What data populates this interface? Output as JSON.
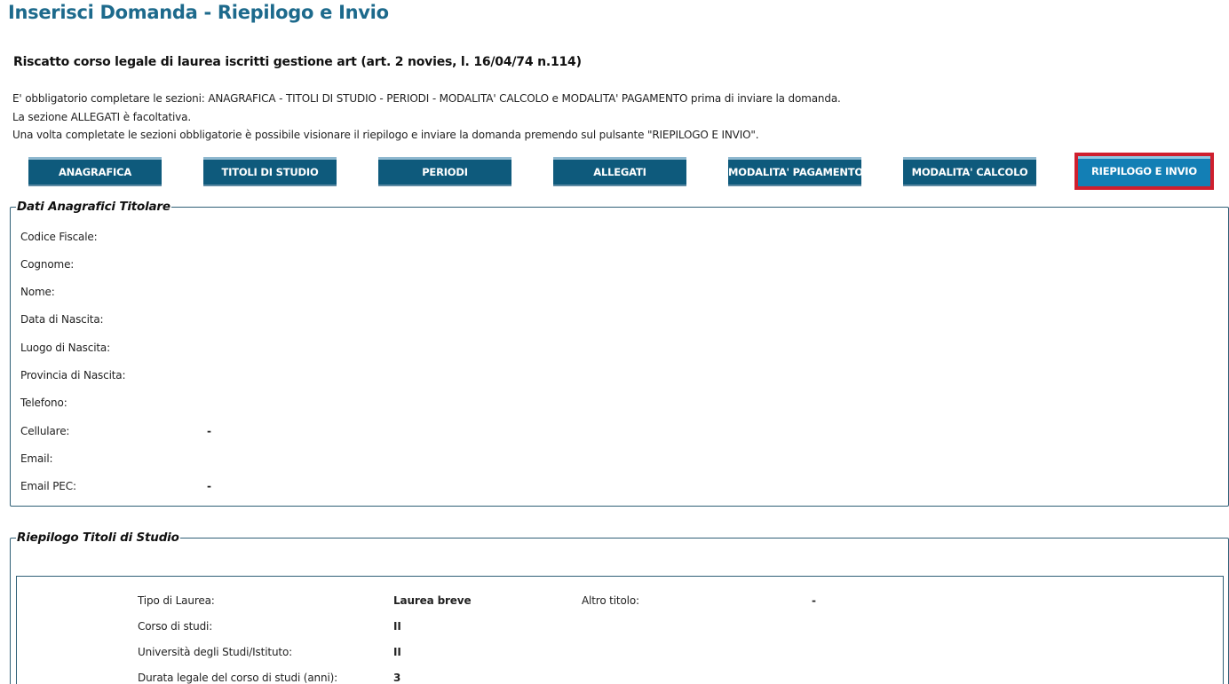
{
  "page": {
    "title": "Inserisci Domanda - Riepilogo e Invio",
    "subtitle": "Riscatto corso legale di laurea iscritti gestione art (art. 2 novies, l. 16/04/74 n.114)",
    "info": [
      "E' obbligatorio completare le sezioni: ANAGRAFICA - TITOLI DI STUDIO - PERIODI - MODALITA' CALCOLO e MODALITA' PAGAMENTO prima di inviare la domanda.",
      "La sezione ALLEGATI è facoltativa.",
      "Una volta completate le sezioni obbligatorie è possibile visionare il riepilogo e inviare la domanda premendo sul pulsante \"RIEPILOGO E INVIO\"."
    ]
  },
  "nav": {
    "anagrafica": "ANAGRAFICA",
    "titoli": "TITOLI DI STUDIO",
    "periodi": "PERIODI",
    "allegati": "ALLEGATI",
    "pagamento": "MODALITA' PAGAMENTO",
    "calcolo": "MODALITA' CALCOLO",
    "riepilogo": "RIEPILOGO E INVIO",
    "active": "RIEPILOGO E INVIO"
  },
  "anagrafici": {
    "legend": "Dati Anagrafici Titolare",
    "fields": [
      {
        "label": "Codice Fiscale:",
        "value": ""
      },
      {
        "label": "Cognome:",
        "value": ""
      },
      {
        "label": "Nome:",
        "value": ""
      },
      {
        "label": "Data di Nascita:",
        "value": ""
      },
      {
        "label": "Luogo di Nascita:",
        "value": ""
      },
      {
        "label": "Provincia di Nascita:",
        "value": ""
      },
      {
        "label": "Telefono:",
        "value": ""
      },
      {
        "label": "Cellulare:",
        "value": "-"
      },
      {
        "label": "Email:",
        "value": ""
      },
      {
        "label": "Email PEC:",
        "value": "-"
      }
    ]
  },
  "titoli": {
    "legend": "Riepilogo Titoli di Studio",
    "tipo_label": "Tipo di Laurea:",
    "tipo_value": "Laurea breve",
    "altro_label": "Altro titolo:",
    "altro_value": "-",
    "corso_label": "Corso di studi:",
    "corso_value": "II",
    "universita_label": "Università degli Studi/Istituto:",
    "universita_value": "II",
    "durata_label": "Durata legale del corso di studi (anni):",
    "durata_value": "3"
  },
  "colors": {
    "title": "#1d6a8c",
    "button": "#0e5a7c",
    "button_active": "#137fb5",
    "active_outline": "#cf1f2e",
    "border": "#2f5f76"
  }
}
